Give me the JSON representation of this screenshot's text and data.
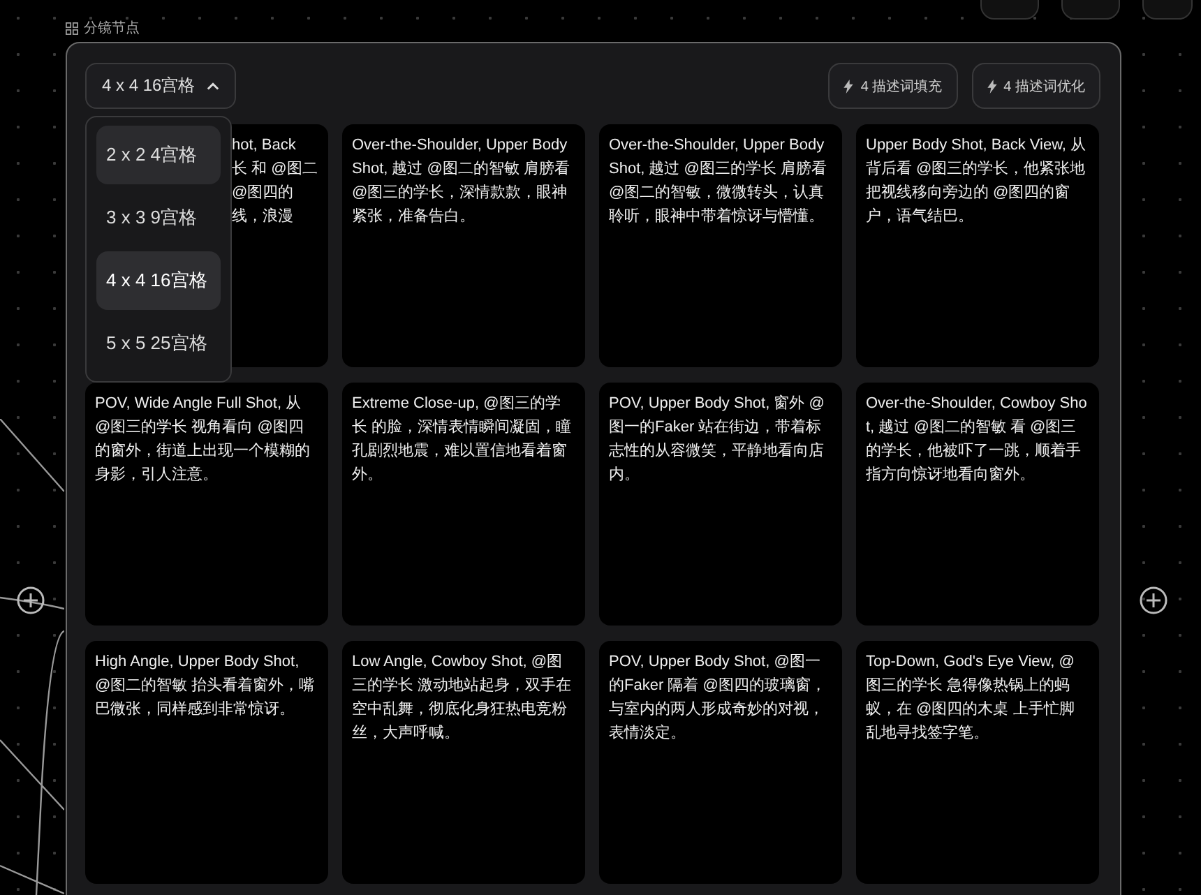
{
  "node_label": "分镜节点",
  "grid_select": {
    "value": "4 x 4 16宫格",
    "expanded": true,
    "options": [
      {
        "label": "2 x 2 4宫格",
        "selected": false,
        "hovered": true
      },
      {
        "label": "3 x 3 9宫格",
        "selected": false,
        "hovered": false
      },
      {
        "label": "4 x 4 16宫格",
        "selected": true,
        "hovered": false
      },
      {
        "label": "5 x 5 25宫格",
        "selected": false,
        "hovered": false
      }
    ]
  },
  "actions": [
    {
      "label": "4 描述词填充"
    },
    {
      "label": "4 描述词优化"
    }
  ],
  "cards": [
    {
      "kind": "covered",
      "lines": [
        "hot, Back",
        "长 和 @图二",
        "@图四的",
        "线，浪漫"
      ]
    },
    {
      "kind": "full",
      "text": "Over-the-Shoulder, Upper Body Shot, 越过 @图二的智敏 肩膀看 @图三的学长，深情款款，眼神紧张，准备告白。"
    },
    {
      "kind": "full",
      "text": "Over-the-Shoulder, Upper Body Shot, 越过 @图三的学长 肩膀看 @图二的智敏，微微转头，认真聆听，眼神中带着惊讶与懵懂。"
    },
    {
      "kind": "full",
      "text": "Upper Body Shot, Back View, 从背后看 @图三的学长，他紧张地把视线移向旁边的 @图四的窗户，语气结巴。"
    },
    {
      "kind": "full",
      "text": "POV, Wide Angle Full Shot, 从 @图三的学长 视角看向 @图四的窗外，街道上出现一个模糊的身影，引人注意。"
    },
    {
      "kind": "full",
      "text": "Extreme Close-up, @图三的学长 的脸，深情表情瞬间凝固，瞳孔剧烈地震，难以置信地看着窗外。"
    },
    {
      "kind": "full",
      "text": "POV, Upper Body Shot, 窗外 @图一的Faker 站在街边，带着标志性的从容微笑，平静地看向店内。"
    },
    {
      "kind": "full",
      "text": "Over-the-Shoulder, Cowboy Shot, 越过 @图二的智敏 看 @图三的学长，他被吓了一跳，顺着手指方向惊讶地看向窗外。"
    },
    {
      "kind": "full",
      "text": "High Angle, Upper Body Shot, @图二的智敏 抬头看着窗外，嘴巴微张，同样感到非常惊讶。"
    },
    {
      "kind": "full",
      "text": "Low Angle, Cowboy Shot, @图三的学长 激动地站起身，双手在空中乱舞，彻底化身狂热电竞粉丝，大声呼喊。"
    },
    {
      "kind": "full",
      "text": "POV, Upper Body Shot, @图一的Faker 隔着 @图四的玻璃窗，与室内的两人形成奇妙的对视，表情淡定。"
    },
    {
      "kind": "full",
      "text": "Top-Down, God's Eye View, @图三的学长 急得像热锅上的蚂蚁，在 @图四的木桌 上手忙脚乱地寻找签字笔。"
    }
  ]
}
